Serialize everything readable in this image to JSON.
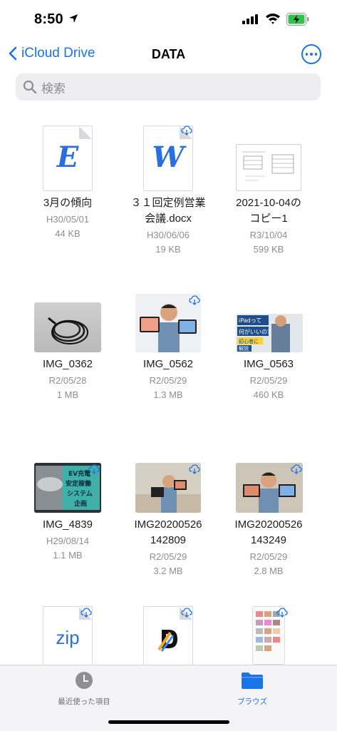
{
  "status": {
    "time": "8:50"
  },
  "nav": {
    "back_label": "iCloud Drive",
    "title": "DATA"
  },
  "search": {
    "placeholder": "検索"
  },
  "files": [
    {
      "name_line1": "3月の傾向",
      "name_line2": "",
      "date": "H30/05/01",
      "size": "44 KB",
      "kind": "E",
      "icon": "excel-document-icon",
      "cloud": false
    },
    {
      "name_line1": "３１回定例営業",
      "name_line2": "会議.docx",
      "date": "H30/06/06",
      "size": "19 KB",
      "kind": "W",
      "icon": "word-document-icon",
      "cloud": true
    },
    {
      "name_line1": "2021-10-04の",
      "name_line2": "コピー1",
      "date": "R3/10/04",
      "size": "599 KB",
      "kind": "page",
      "icon": "document-preview-icon",
      "cloud": false
    },
    {
      "name_line1": "IMG_0362",
      "name_line2": "",
      "date": "R2/05/28",
      "size": "1 MB",
      "kind": "photo",
      "icon": "photo-cable-icon",
      "cloud": false
    },
    {
      "name_line1": "IMG_0562",
      "name_line2": "",
      "date": "R2/05/29",
      "size": "1.3 MB",
      "kind": "photo",
      "icon": "photo-person-tablet-icon",
      "cloud": true
    },
    {
      "name_line1": "IMG_0563",
      "name_line2": "",
      "date": "R2/05/29",
      "size": "460 KB",
      "kind": "photo",
      "icon": "photo-thumbnail-icon",
      "cloud": false,
      "caption_lines": [
        "iPadって",
        "何がいいの？",
        "初心者に",
        "解説"
      ]
    },
    {
      "name_line1": "IMG_4839",
      "name_line2": "",
      "date": "H29/08/14",
      "size": "1.1 MB",
      "kind": "photo",
      "icon": "photo-ev-icon",
      "cloud": true,
      "caption_lines": [
        "EV充電",
        "安定稼働",
        "システム",
        "企画"
      ]
    },
    {
      "name_line1": "IMG20200526",
      "name_line2": "142809",
      "date": "R2/05/29",
      "size": "3.2 MB",
      "kind": "photo",
      "icon": "photo-person-room-icon",
      "cloud": true
    },
    {
      "name_line1": "IMG20200526",
      "name_line2": "143249",
      "date": "R2/05/29",
      "size": "2.8 MB",
      "kind": "photo",
      "icon": "photo-person-room-icon",
      "cloud": true
    },
    {
      "name_line1": "",
      "name_line2": "",
      "date": "",
      "size": "",
      "kind": "zip",
      "label": "zip",
      "icon": "zip-archive-icon",
      "cloud": true
    },
    {
      "name_line1": "",
      "name_line2": "",
      "date": "",
      "size": "",
      "kind": "app",
      "icon": "d-app-document-icon",
      "cloud": true
    },
    {
      "name_line1": "",
      "name_line2": "",
      "date": "",
      "size": "",
      "kind": "screenshot",
      "icon": "screenshot-thumbnail-icon",
      "cloud": true
    }
  ],
  "tabs": {
    "recents": "最近使った項目",
    "browse": "ブラウズ"
  },
  "colors": {
    "accent": "#1a73e8",
    "secondary_text": "#8e8e93"
  }
}
